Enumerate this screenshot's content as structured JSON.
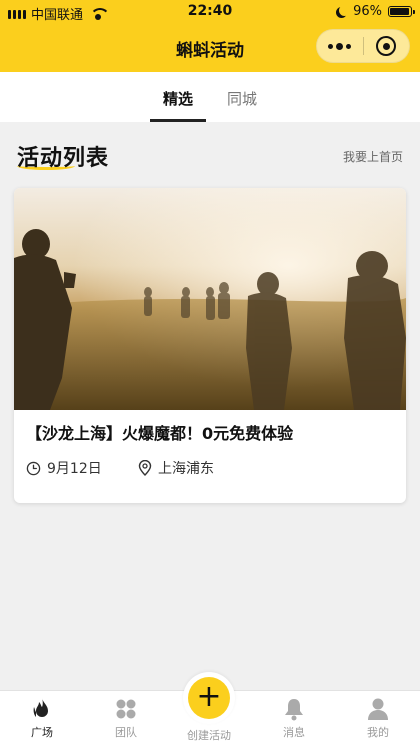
{
  "status_bar": {
    "carrier": "中国联通",
    "time": "22:40",
    "battery": "96%",
    "battery_level": 0.96
  },
  "nav": {
    "title": "蝌蚪活动",
    "background": "#fbcf1d",
    "more_icon": "more-dots-icon",
    "close_icon": "target-close-icon"
  },
  "tabs": {
    "items": [
      {
        "label": "精选",
        "active": true
      },
      {
        "label": "同城",
        "active": false
      }
    ]
  },
  "section": {
    "title": "活动列表",
    "link": "我要上首页"
  },
  "activity": {
    "title": "【沙龙上海】火爆魔都！0元免费体验",
    "date": "9月12日",
    "location": "上海浦东",
    "date_icon": "clock-icon",
    "location_icon": "location-pin-icon"
  },
  "tabbar": {
    "items": [
      {
        "label": "广场",
        "icon": "flame-icon",
        "active": true
      },
      {
        "label": "团队",
        "icon": "team-grid-icon",
        "active": false
      },
      {
        "label": "创建活动",
        "icon": "plus-icon",
        "active": false
      },
      {
        "label": "消息",
        "icon": "bell-icon",
        "active": false
      },
      {
        "label": "我的",
        "icon": "user-icon",
        "active": false
      }
    ],
    "accent": "#fbcf1d"
  }
}
